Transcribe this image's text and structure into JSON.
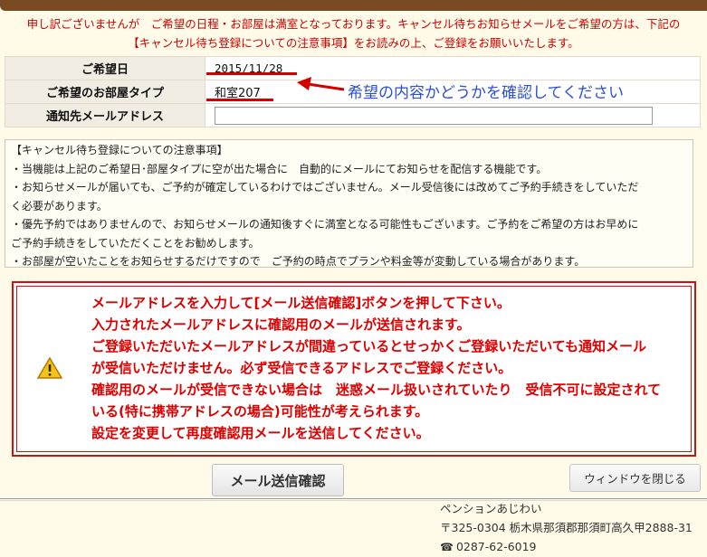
{
  "notice": {
    "line1": "申し訳ございませんが　ご希望の日程・お部屋は満室となっております。キャンセル待ちお知らせメールをご希望の方は、下記の",
    "line2": "【キャンセル待ち登録についての注意事項】をお読みの上、ご登録をお願いいたします。"
  },
  "form": {
    "date_label": "ご希望日",
    "date_value": "2015/11/28",
    "room_label": "ご希望のお部屋タイプ",
    "room_value": "和室207",
    "email_label": "通知先メールアドレス",
    "email_value": ""
  },
  "annotation": "希望の内容かどうかを確認してください",
  "cautions": {
    "title": "【キャンセル待ち登録についての注意事項】",
    "lines": [
      "・当機能は上記のご希望日･部屋タイプに空が出た場合に　自動的にメールにてお知らせを配信する機能です。",
      "・お知らせメールが届いても、ご予約が確定しているわけではございません。メール受信後には改めてご予約手続きをしていただ",
      "く必要があります。",
      "・優先予約ではありませんので、お知らせメールの通知後すぐに満室となる可能性もございます。ご予約をご希望の方はお早めに",
      "ご予約手続きをしていただくことをお勧めします。",
      "・お部屋が空いたことをお知らせするだけですので　ご予約の時点でプランや料金等が変動している場合があります。"
    ]
  },
  "warning": {
    "icon": "warning-icon",
    "lines": [
      "メールアドレスを入力して[メール送信確認]ボタンを押して下さい。",
      "入力されたメールアドレスに確認用のメールが送信されます。",
      "ご登録いただいたメールアドレスが間違っているとせっかくご登録いただいても通知メール",
      "が受信いただけません。必ず受信できるアドレスでご登録ください。",
      "確認用のメールが受信できない場合は　迷惑メール扱いされていたり　受信不可に設定されて",
      "いる(特に携帯アドレスの場合)可能性が考えられます。",
      "設定を変更して再度確認用メールを送信してください。"
    ]
  },
  "buttons": {
    "send": "メール送信確認",
    "close": "ウィンドウを閉じる"
  },
  "footer": {
    "name": "ペンションあじわい",
    "address": "〒325-0304 栃木県那須郡那須町高久甲2888-31",
    "phone": "0287-62-6019"
  },
  "colors": {
    "notice_red": "#cc0000",
    "annotation_blue": "#2b4fd6",
    "warning_red": "#dd0000",
    "page_bg": "#fffbe8"
  }
}
